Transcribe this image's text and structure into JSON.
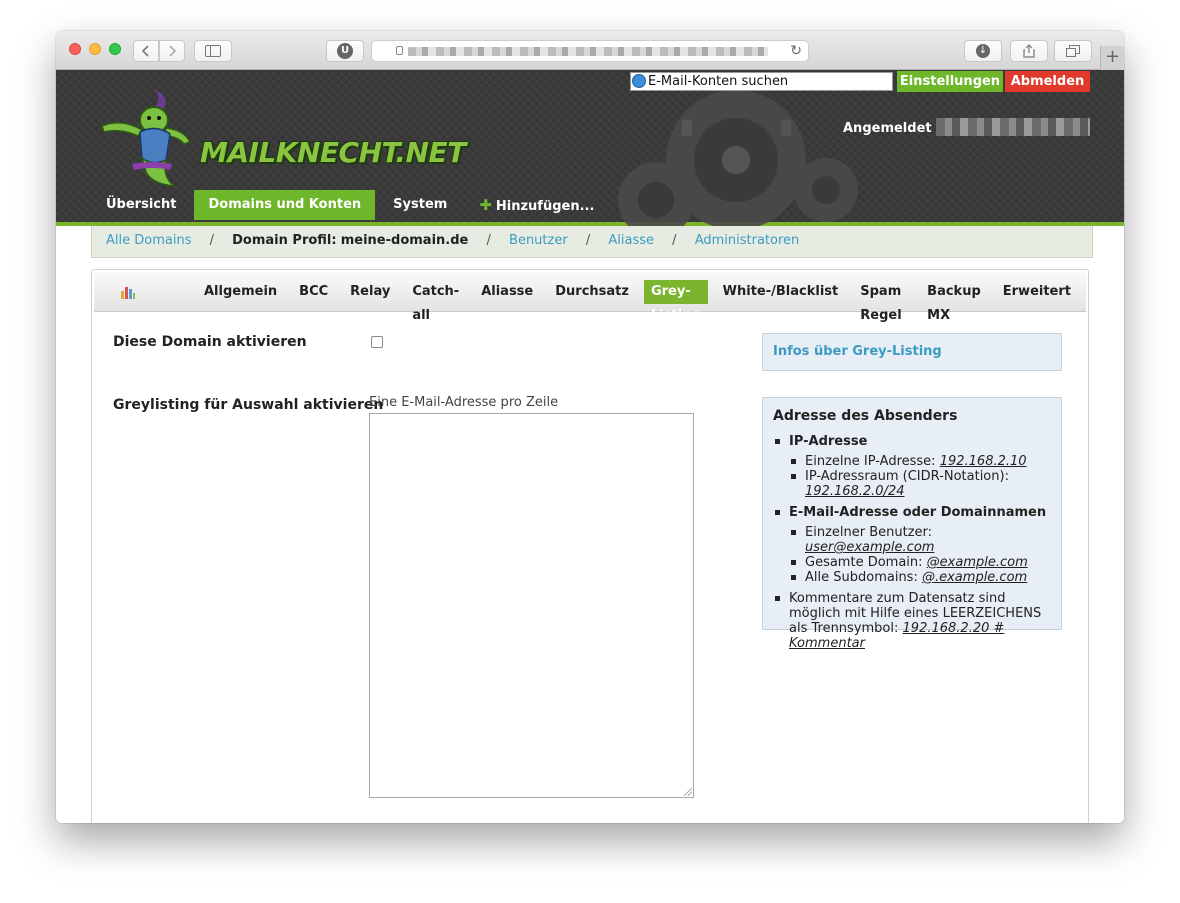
{
  "browser": {
    "reader_badge": "U",
    "new_tab_symbol": "+"
  },
  "header": {
    "search_value": "E-Mail-Konten suchen",
    "settings_label": "Einstellungen",
    "logout_label": "Abmelden",
    "logo_text": "MAILKNECHT.NET",
    "logged_in_label": "Angemeldet als",
    "nav": [
      {
        "label": "Übersicht"
      },
      {
        "label": "Domains und Konten"
      },
      {
        "label": "System"
      },
      {
        "label": "Hinzufügen..."
      }
    ],
    "colors": {
      "accent": "#6fb72a",
      "logout": "#e03a2c",
      "header_bg": "#3a3a3a"
    }
  },
  "breadcrumb": {
    "all_domains": "Alle Domains",
    "sep": "/",
    "profile_label": "Domain Profil:",
    "profile_domain": "meine-domain.de",
    "users": "Benutzer",
    "aliases": "Aliasse",
    "admins": "Administratoren"
  },
  "tabs": [
    "Allgemein",
    "BCC",
    "Relay",
    "Catch-all",
    "Aliasse",
    "Durchsatz",
    "Grey-Listing",
    "White-/Blacklist",
    "Spam Regel",
    "Backup MX",
    "Erweitert"
  ],
  "form": {
    "activate_label": "Diese Domain aktivieren",
    "activate_checked": false,
    "greylist_label": "Greylisting für Auswahl aktivieren",
    "textarea_hint": "Eine E-Mail-Adresse pro Zeile",
    "textarea_value": ""
  },
  "info": {
    "link_label": "Infos über Grey-Listing",
    "sender_title": "Adresse des Absenders",
    "ip_heading": "IP-Adresse",
    "single_ip_label": "Einzelne IP-Adresse:",
    "single_ip_example": "192.168.2.10",
    "ip_range_label": "IP-Adressraum (CIDR-Notation):",
    "ip_range_example": "192.168.2.0/24",
    "mail_heading": "E-Mail-Adresse oder Domainnamen",
    "single_user_label": "Einzelner Benutzer:",
    "single_user_example": "user@example.com",
    "whole_domain_label": "Gesamte Domain:",
    "whole_domain_example": "@example.com",
    "subdomains_label": "Alle Subdomains:",
    "subdomains_example": "@.example.com",
    "comment_text": "Kommentare zum Datensatz sind möglich mit Hilfe eines LEERZEICHENS als Trennsymbol:",
    "comment_example": "192.168.2.20 # Kommentar"
  }
}
